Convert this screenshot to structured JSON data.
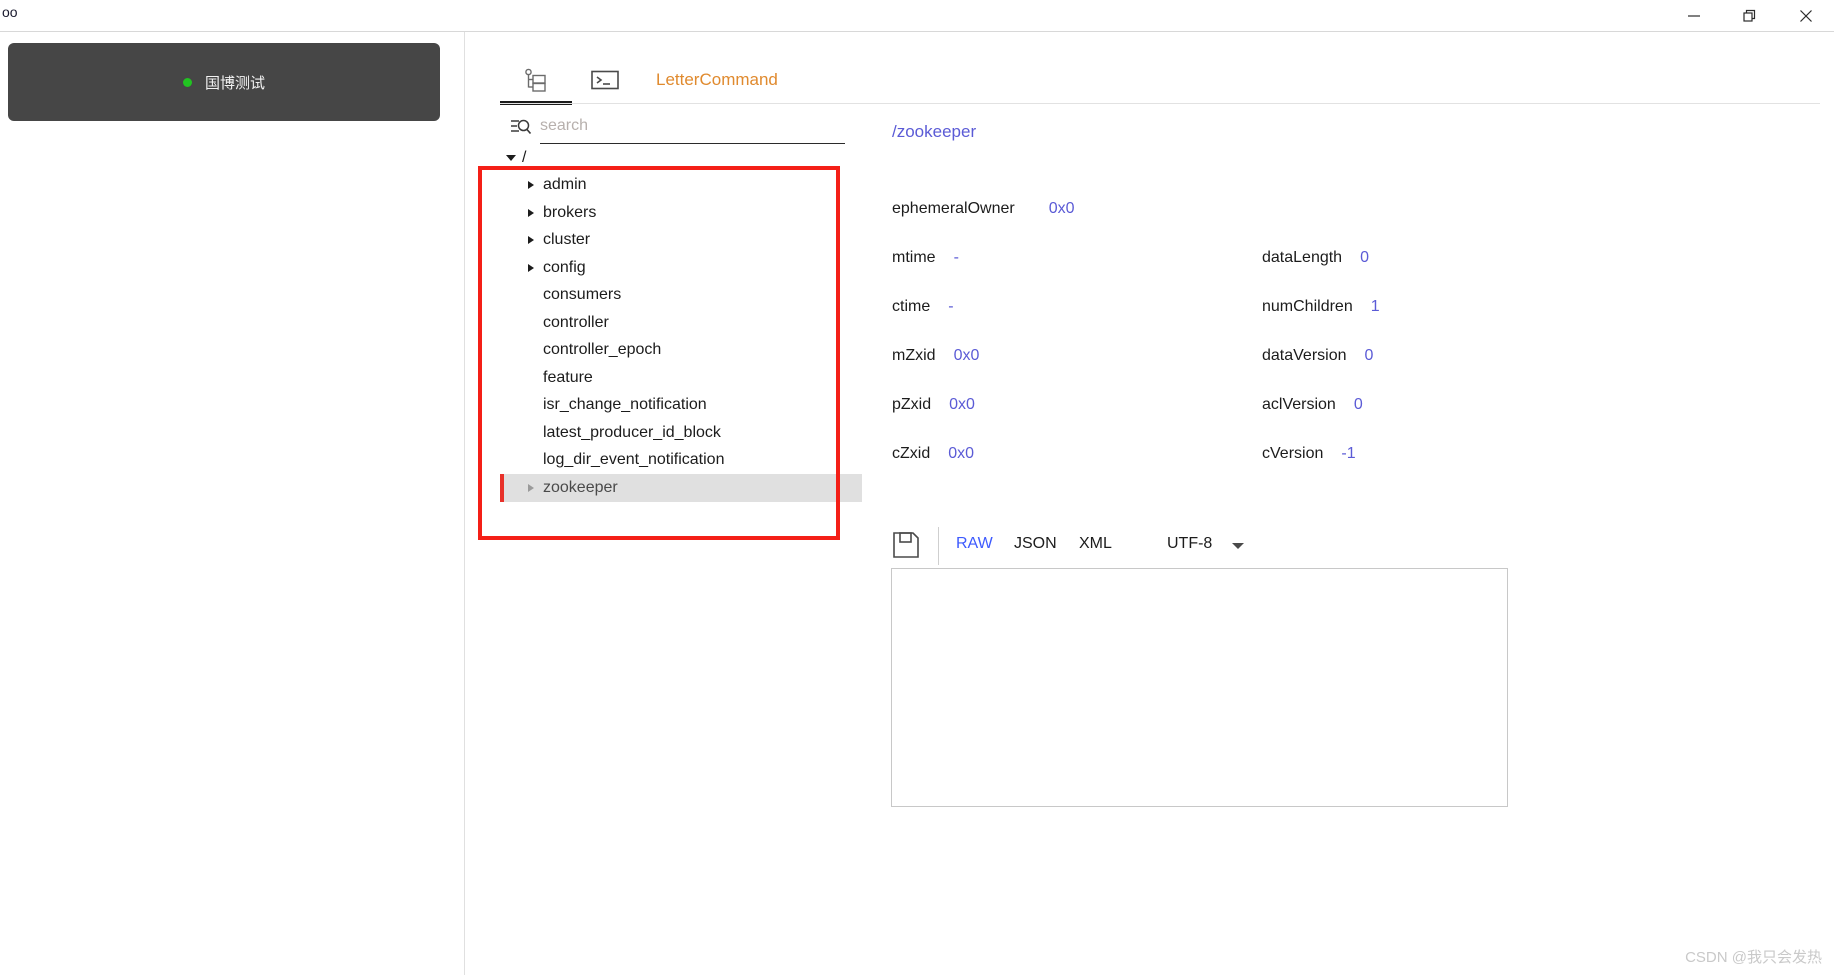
{
  "window": {
    "title_fragment": "oo",
    "controls": [
      {
        "name": "minimize",
        "glyph": "minimize-icon"
      },
      {
        "name": "restore",
        "glyph": "restore-icon"
      },
      {
        "name": "close",
        "glyph": "close-icon"
      }
    ]
  },
  "connection": {
    "name": "国博测试",
    "status_color": "#21c421",
    "card_color": "#464646"
  },
  "tabs": [
    {
      "id": "tree",
      "icon": "tree-view-icon",
      "label": "",
      "active": true
    },
    {
      "id": "command",
      "icon": "terminal-icon",
      "label": "",
      "active": false
    },
    {
      "id": "letter",
      "icon": "",
      "label": "LetterCommand",
      "active": false,
      "color": "#e08a2e"
    }
  ],
  "search": {
    "placeholder": "search",
    "value": "",
    "icon": "filter-search-icon"
  },
  "tree": {
    "root": {
      "label": "/",
      "expanded": true
    },
    "nodes": [
      {
        "label": "admin",
        "expandable": true,
        "selected": false
      },
      {
        "label": "brokers",
        "expandable": true,
        "selected": false
      },
      {
        "label": "cluster",
        "expandable": true,
        "selected": false
      },
      {
        "label": "config",
        "expandable": true,
        "selected": false
      },
      {
        "label": "consumers",
        "expandable": false,
        "selected": false
      },
      {
        "label": "controller",
        "expandable": false,
        "selected": false
      },
      {
        "label": "controller_epoch",
        "expandable": false,
        "selected": false
      },
      {
        "label": "feature",
        "expandable": false,
        "selected": false
      },
      {
        "label": "isr_change_notification",
        "expandable": false,
        "selected": false
      },
      {
        "label": "latest_producer_id_block",
        "expandable": false,
        "selected": false
      },
      {
        "label": "log_dir_event_notification",
        "expandable": false,
        "selected": false
      },
      {
        "label": "zookeeper",
        "expandable": true,
        "selected": true
      }
    ],
    "annotation_color": "#f41f17"
  },
  "node_detail": {
    "path": "/zookeeper",
    "path_color": "#5b5bd6",
    "left_props": [
      {
        "key": "ephemeralOwner",
        "value": "0x0"
      },
      {
        "key": "mtime",
        "value": "-"
      },
      {
        "key": "ctime",
        "value": "-"
      },
      {
        "key": "mZxid",
        "value": "0x0"
      },
      {
        "key": "pZxid",
        "value": "0x0"
      },
      {
        "key": "cZxid",
        "value": "0x0"
      }
    ],
    "right_props": [
      {
        "key": "dataLength",
        "value": "0"
      },
      {
        "key": "numChildren",
        "value": "1"
      },
      {
        "key": "dataVersion",
        "value": "0"
      },
      {
        "key": "aclVersion",
        "value": "0"
      },
      {
        "key": "cVersion",
        "value": "-1"
      }
    ]
  },
  "editor": {
    "save_icon": "save-floppy-icon",
    "formats": [
      {
        "label": "RAW",
        "active": true
      },
      {
        "label": "JSON",
        "active": false
      },
      {
        "label": "XML",
        "active": false
      }
    ],
    "encoding": "UTF-8",
    "encoding_caret": "chevron-down-icon",
    "content": "",
    "active_color": "#3d5afe"
  },
  "watermark": "CSDN @我只会发热"
}
